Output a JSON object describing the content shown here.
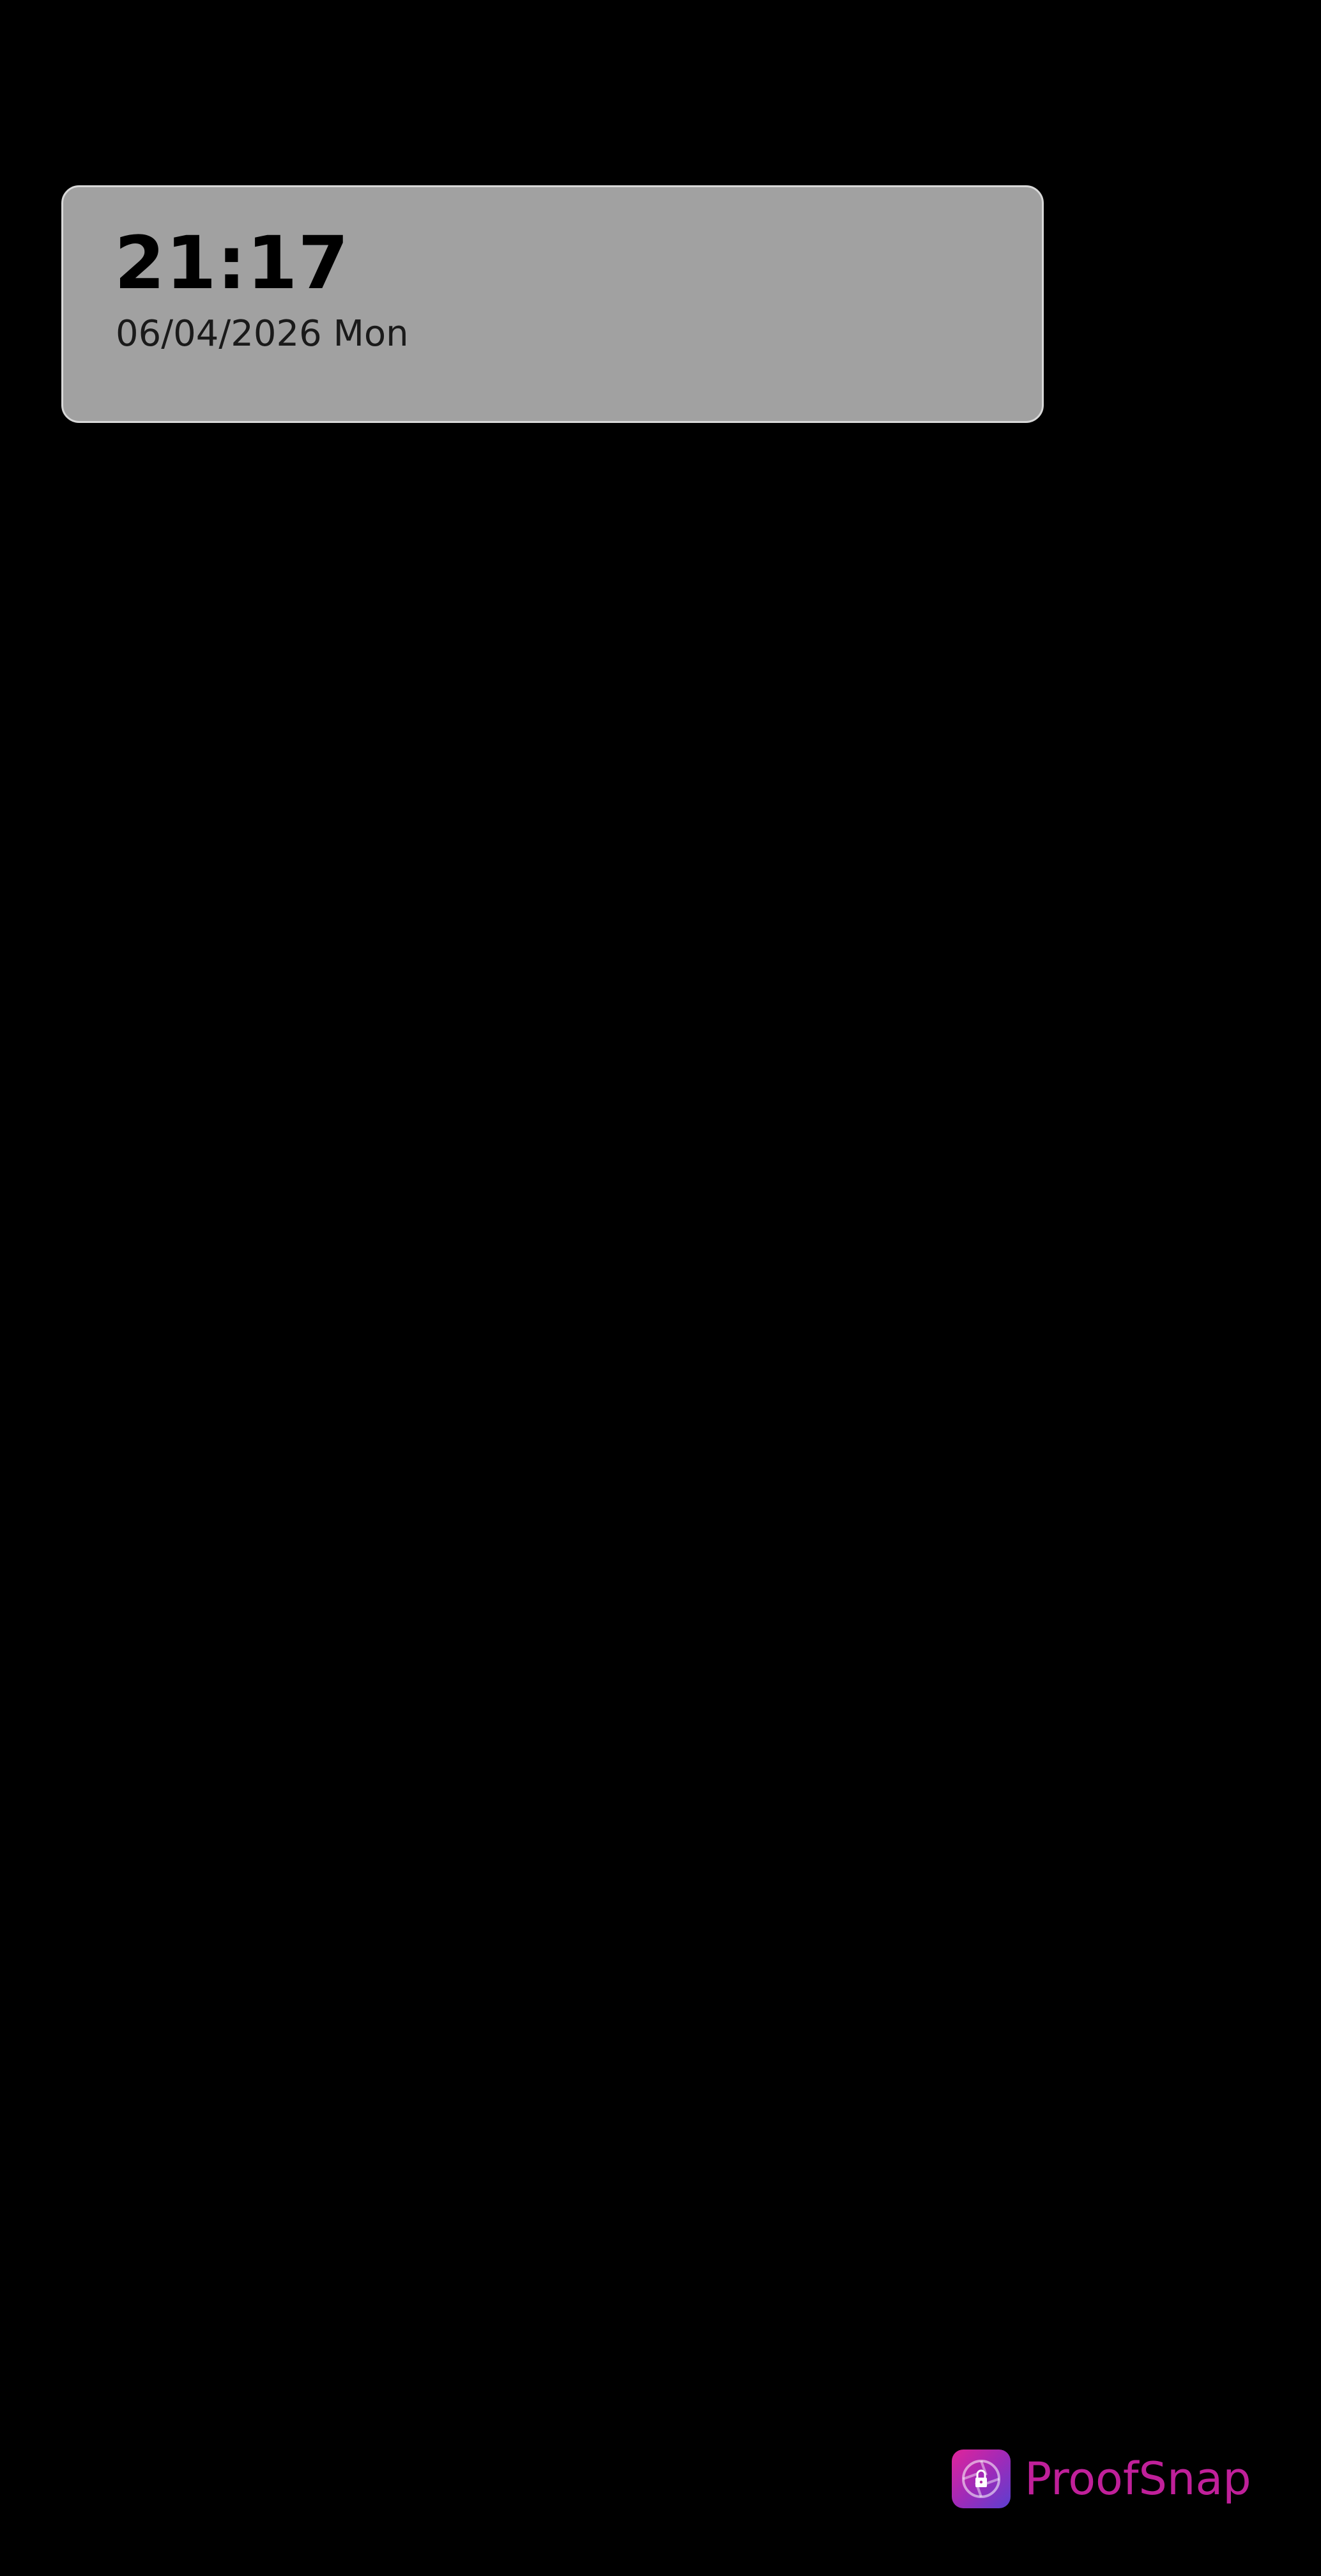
{
  "timestamp": {
    "time": "21:17",
    "date": "06/04/2026 Mon"
  },
  "watermark": {
    "brand": "ProofSnap",
    "icon": "proofsnap-lock-icon",
    "brand_color": "#c0209a"
  },
  "colors": {
    "background": "#000000",
    "card_background": "#a1a1a1"
  }
}
